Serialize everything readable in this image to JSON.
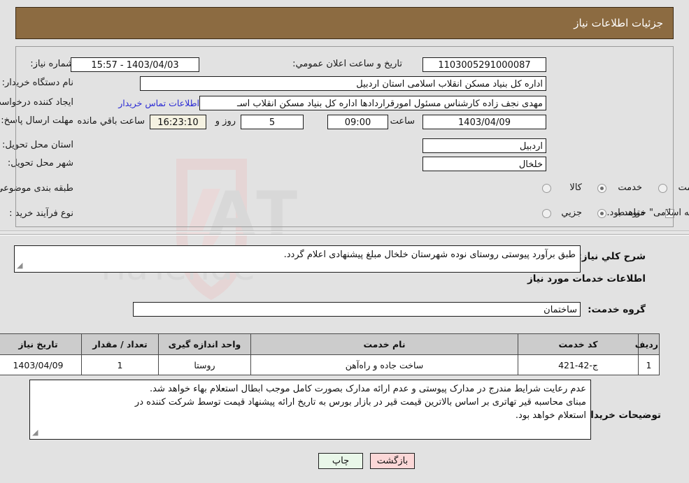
{
  "header": {
    "title": "جزئیات اطلاعات نیاز"
  },
  "form": {
    "need_number_label": "شماره نیاز:",
    "need_number_value": "1103005291000087",
    "announce_label": "تاریخ و ساعت اعلان عمومي:",
    "announce_value": "1403/04/03 - 15:57",
    "buyer_org_label": "نام دستگاه خریدار:",
    "buyer_org_value": "اداره کل بنیاد مسکن انقلاب اسلامی استان اردبیل",
    "creator_label": "ایجاد کننده درخواست:",
    "creator_value": "مهدی نجف زاده کارشناس مسئول امورقراردادها اداره کل بنیاد مسکن انقلاب اسـ",
    "contact_link": "اطلاعات تماس خریدار",
    "deadline_label": "مهلت ارسال پاسخ: تا تاریخ:",
    "deadline_date": "1403/04/09",
    "hour_label": "ساعت",
    "deadline_time": "09:00",
    "days_remaining": "5",
    "days_word": "روز و",
    "time_remaining": "16:23:10",
    "remaining_suffix": "ساعت باقي مانده",
    "province_label": "استان محل تحویل:",
    "province_value": "اردبیل",
    "city_label": "شهر محل تحویل:",
    "city_value": "خلخال",
    "category_label": "طبقه بندی موضوعی:",
    "category_options": [
      "کالا",
      "خدمت",
      "کالا/خدمت"
    ],
    "category_selected": "خدمت",
    "purchase_type_label": "نوع فرآیند خرید :",
    "purchase_options": [
      "جزیي",
      "متوسط"
    ],
    "purchase_selected": "متوسط",
    "treasury_note": "پرداخت تمام یا بخشی از مبلغ خرید،از محل \"اسناد خزانه اسلامی\" خواهد بود."
  },
  "description": {
    "label": "شرح کلي نیاز:",
    "value": "طبق برآورد پیوستی روستای نوده شهرستان خلخال مبلغ پیشنهادی اعلام گردد."
  },
  "services_section": {
    "heading": "اطلاعات خدمات مورد نیاز",
    "group_label": "گروه خدمت:",
    "group_value": "ساختمان"
  },
  "table": {
    "columns": [
      "ردیف",
      "کد خدمت",
      "نام خدمت",
      "واحد اندازه گیری",
      "تعداد / مقدار",
      "تاریخ نیاز"
    ],
    "rows": [
      {
        "index": "1",
        "code": "ج-42-421",
        "name": "ساخت جاده و راه‌آهن",
        "unit": "روستا",
        "qty": "1",
        "need_date": "1403/04/09"
      }
    ]
  },
  "buyer_notes": {
    "label": "توضیحات خریدار:",
    "line1": "عدم رعایت شرایط مندرج در مدارک پیوستی و عدم ارائه مدارک بصورت کامل موجب ابطال استعلام بهاء خواهد شد.",
    "line2": "مبنای محاسبه قیر تهاتری بر اساس بالاترین قیمت قیر در بازار بورس به تاریخ ارائه پیشنهاد قیمت توسط شرکت کننده در",
    "line3": "استعلام خواهد بود."
  },
  "footer": {
    "print_label": "چاپ",
    "back_label": "بازگشت"
  },
  "colors": {
    "header_brown": "#8c6b41",
    "page_bg": "#e2e2e2",
    "link_blue": "#2b2bd4",
    "table_header_gray": "#cccccc",
    "print_btn_bg": "#e9f7e9",
    "back_btn_bg": "#fbd7d7",
    "highlight_beige": "#f5f2e2"
  }
}
